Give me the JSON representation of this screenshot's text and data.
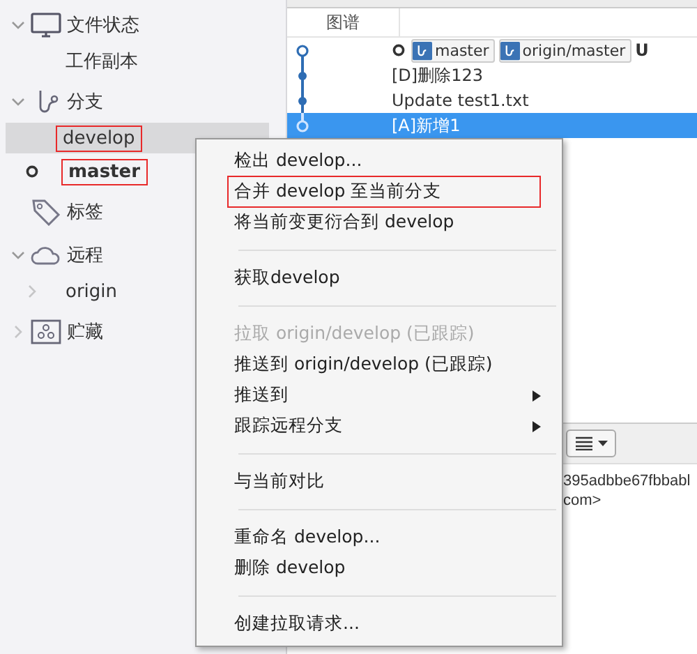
{
  "sidebar": [
    {
      "label": "文件状态",
      "expanded": true,
      "children": [
        {
          "label": "工作副本",
          "selected": false
        }
      ]
    },
    {
      "label": "分支",
      "expanded": true,
      "children": [
        {
          "label": "develop",
          "selected": true,
          "current": false,
          "annotated": true
        },
        {
          "label": "master",
          "selected": false,
          "current": true,
          "annotated": true
        }
      ]
    },
    {
      "label": "标签"
    },
    {
      "label": "远程",
      "expanded": true,
      "children": [
        {
          "label": "origin",
          "selected": false,
          "expanded": false
        }
      ]
    },
    {
      "label": "贮藏",
      "expanded": false
    }
  ],
  "graph": {
    "column": "图谱",
    "commits": [
      {
        "kind": "hollow",
        "head": true,
        "refs": [
          "master",
          "origin/master"
        ],
        "message": "U",
        "selected": false
      },
      {
        "kind": "filled",
        "message": "[D]删除123",
        "selected": false
      },
      {
        "kind": "filled",
        "message": "Update test1.txt",
        "selected": false
      },
      {
        "kind": "hollow",
        "message": "[A]新增1",
        "selected": true
      }
    ]
  },
  "details": {
    "lines": [
      "395adbbe67fbbabl",
      "com>"
    ]
  },
  "context_menu": [
    {
      "kind": "item",
      "label": "检出 develop..."
    },
    {
      "kind": "item",
      "label": "合并 develop 至当前分支",
      "annotated": true
    },
    {
      "kind": "item",
      "label": "将当前变更衍合到 develop"
    },
    {
      "kind": "separator"
    },
    {
      "kind": "item",
      "label": "获取develop"
    },
    {
      "kind": "separator"
    },
    {
      "kind": "item",
      "label": "拉取 origin/develop (已跟踪)",
      "disabled": true
    },
    {
      "kind": "item",
      "label": "推送到 origin/develop (已跟踪)"
    },
    {
      "kind": "item",
      "label": "推送到",
      "submenu": true
    },
    {
      "kind": "item",
      "label": "跟踪远程分支",
      "submenu": true
    },
    {
      "kind": "separator"
    },
    {
      "kind": "item",
      "label": "与当前对比"
    },
    {
      "kind": "separator"
    },
    {
      "kind": "item",
      "label": "重命名 develop..."
    },
    {
      "kind": "item",
      "label": "删除 develop"
    },
    {
      "kind": "separator"
    },
    {
      "kind": "item",
      "label": "创建拉取请求..."
    }
  ]
}
